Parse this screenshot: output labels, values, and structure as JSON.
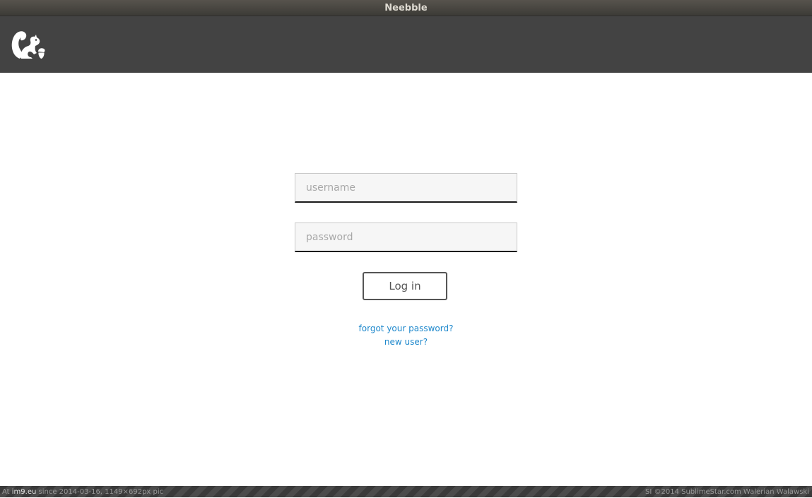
{
  "window": {
    "title": "Neebble"
  },
  "header": {
    "logo_icon": "squirrel-icon"
  },
  "login": {
    "username_placeholder": "username",
    "password_placeholder": "password",
    "login_label": "Log in",
    "forgot_link": "forgot your password?",
    "new_user_link": "new user?"
  },
  "footer": {
    "left_prefix": "At",
    "left_site": "im9.eu",
    "left_rest": "since 2014-03-16, 1149×692px pic",
    "right": "SI ©2014 SublimeStar.com Walerian Walawski"
  },
  "colors": {
    "header_bg": "#434343",
    "link": "#1e88cc",
    "field_bg": "#f6f6f6"
  }
}
